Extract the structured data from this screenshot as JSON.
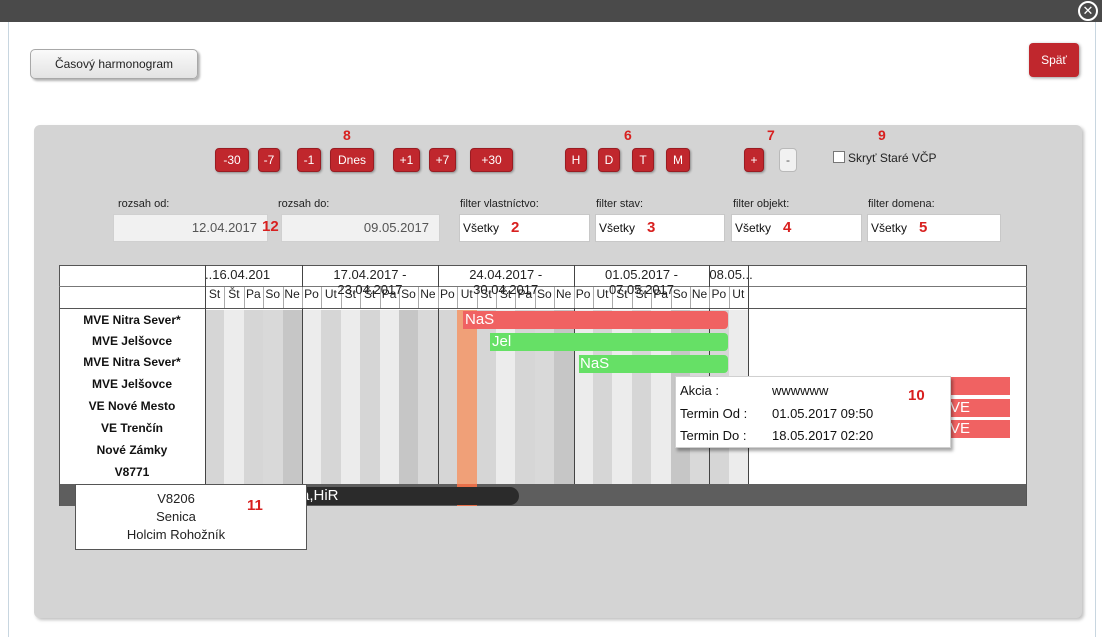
{
  "window": {
    "close_icon": "close-icon"
  },
  "toolbar_top": {
    "harmonogram_label": "Časový harmonogram",
    "back_label": "Späť"
  },
  "nav_buttons": [
    "-30",
    "-7",
    "-1",
    "Dnes",
    "+1",
    "+7",
    "+30"
  ],
  "view_buttons": [
    "H",
    "D",
    "T",
    "M"
  ],
  "zoom_buttons": {
    "plus": "+",
    "minus": "-"
  },
  "hide_old": {
    "label": "Skryť Staré VČP",
    "checked": false
  },
  "markers": {
    "m8": "8",
    "m6": "6",
    "m7": "7",
    "m9": "9",
    "m12": "12",
    "m2": "2",
    "m3": "3",
    "m4": "4",
    "m5": "5",
    "m10": "10",
    "m11": "11"
  },
  "range": {
    "from_label": "rozsah od:",
    "from_value": "12.04.2017",
    "to_label": "rozsah do:",
    "to_value": "09.05.2017"
  },
  "filters": {
    "ownership_label": "filter vlastníctvo:",
    "ownership_value": "Všetky",
    "state_label": "filter stav:",
    "state_value": "Všetky",
    "object_label": "filter objekt:",
    "object_value": "Všetky",
    "domain_label": "filter domena:",
    "domain_value": "Všetky"
  },
  "gantt": {
    "weeks": [
      "..16.04.201",
      "17.04.2017 - 23.04.2017",
      "24.04.2017 - 30.04.2017",
      "01.05.2017 - 07.05.2017",
      "08.05..."
    ],
    "days": [
      "St",
      "Št",
      "Pa",
      "So",
      "Ne",
      "Po",
      "Ut",
      "St",
      "Št",
      "Pa",
      "So",
      "Ne",
      "Po",
      "Ut",
      "St",
      "Št",
      "Pa",
      "So",
      "Ne",
      "Po",
      "Ut",
      "St",
      "Št",
      "Pa",
      "So",
      "Ne",
      "Po",
      "Ut"
    ],
    "rows": [
      "MVE Nitra Sever*",
      "MVE Jelšovce",
      "MVE Nitra Sever*",
      "MVE Jelšovce",
      "VE Nové Mesto",
      "VE Trenčín",
      "Nové Zámky",
      "V8771"
    ],
    "bars": {
      "b1": "NaS",
      "b2": "Jel",
      "b3": "NaS",
      "b5": "VE",
      "b6": "VE",
      "b7": "a,HiR"
    },
    "today_color": "#e8704a",
    "red_bar_color": "#f06060",
    "green_bar_color": "#66e066"
  },
  "tooltip_action": {
    "akcia_label": "Akcia :",
    "akcia_value": "wwwwww",
    "od_label": "Termin Od :",
    "od_value": "01.05.2017 09:50",
    "do_label": "Termin Do :",
    "do_value": "18.05.2017 02:20"
  },
  "tooltip_object": {
    "line1": "V8206",
    "line2": "Senica",
    "line3": "Holcim Rohožník"
  }
}
